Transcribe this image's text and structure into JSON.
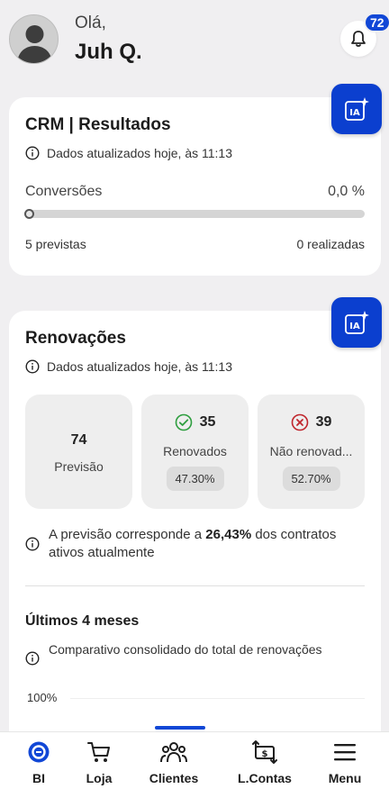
{
  "header": {
    "greeting": "Olá,",
    "user_name": "Juh Q.",
    "notification_count": "72"
  },
  "crm_card": {
    "title": "CRM | Resultados",
    "updated_text": "Dados atualizados hoje, às 11:13",
    "conversions_label": "Conversões",
    "conversions_value": "0,0 %",
    "conversions_progress": 0.0,
    "expected_text": "5  previstas",
    "done_text": "0  realizadas"
  },
  "renewals_card": {
    "title": "Renovações",
    "updated_text": "Dados atualizados hoje, às 11:13",
    "stats": [
      {
        "value": "74",
        "label": "Previsão"
      },
      {
        "value": "35",
        "label": "Renovados",
        "percent": "47.30%"
      },
      {
        "value": "39",
        "label": "Não renovad...",
        "percent": "52.70%"
      }
    ],
    "note_prefix": "A previsão corresponde a ",
    "note_value": "26,43%",
    "note_suffix": " dos contratos ativos atualmente",
    "last_months_title": "Últimos 4 meses",
    "comparative_text": "Comparativo consolidado do total de renovações",
    "y_axis_label": "100%"
  },
  "nav": {
    "items": [
      {
        "label": "BI"
      },
      {
        "label": "Loja"
      },
      {
        "label": "Clientes"
      },
      {
        "label": "L.Contas"
      },
      {
        "label": "Menu"
      }
    ]
  },
  "colors": {
    "accent": "#1147d6",
    "ia_button": "#0b3fcf",
    "success": "#2e9e3f",
    "danger": "#c0262d"
  },
  "icons": {
    "avatar": "user-avatar",
    "bell": "bell-icon",
    "ia": "ai-sparkle-icon",
    "info": "info-icon"
  }
}
